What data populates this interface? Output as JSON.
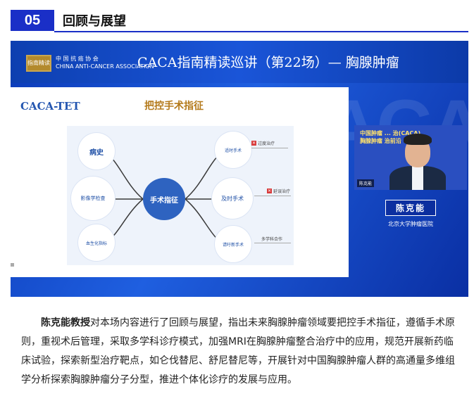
{
  "section": {
    "number": "05",
    "title": "回顾与展望"
  },
  "frame": {
    "bg_text": "CACA",
    "logo_text": "指南精读",
    "association_cn": "中 国 抗 癌 协 会",
    "association_en": "CHINA ANTI-CANCER ASSOCIATION",
    "live_title": "CACA指南精读巡讲（第22场）— 胸腺肿瘤"
  },
  "slide": {
    "logo": "CACA-TET",
    "title": "把控手术指征",
    "center": "手术指征",
    "left_nodes": [
      "病史",
      "影像学检查",
      "血生化指标"
    ],
    "right_nodes": [
      "适时手术",
      "及时手术",
      "请吁新手术"
    ],
    "tags": [
      "过度治疗",
      "延误治疗",
      "多学科合作"
    ]
  },
  "speaker": {
    "cam_text_line1": "中国肿瘤 ... 治(CACA)",
    "cam_text_line2": "胸腺肿瘤 治前沿",
    "cam_label": "陈克能",
    "name": "陈克能",
    "org": "北京大学肿瘤医院"
  },
  "paragraph": {
    "bold": "陈克能教授",
    "text": "对本场内容进行了回顾与展望，指出未来胸腺肿瘤领域要把控手术指征，遵循手术原则，重视术后管理，采取多学科诊疗模式，加强MRI在胸腺肿瘤整合治疗中的应用，规范开展新药临床试验，探索新型治疗靶点，如仑伐替尼、舒尼替尼等，开展针对中国胸腺肿瘤人群的高通量多维组学分析探索胸腺肿瘤分子分型，推进个体化诊疗的发展与应用。"
  },
  "colors": {
    "accent": "#1a2fc7",
    "slide_blue": "#2e63c0",
    "slide_gold": "#b47a1b"
  }
}
